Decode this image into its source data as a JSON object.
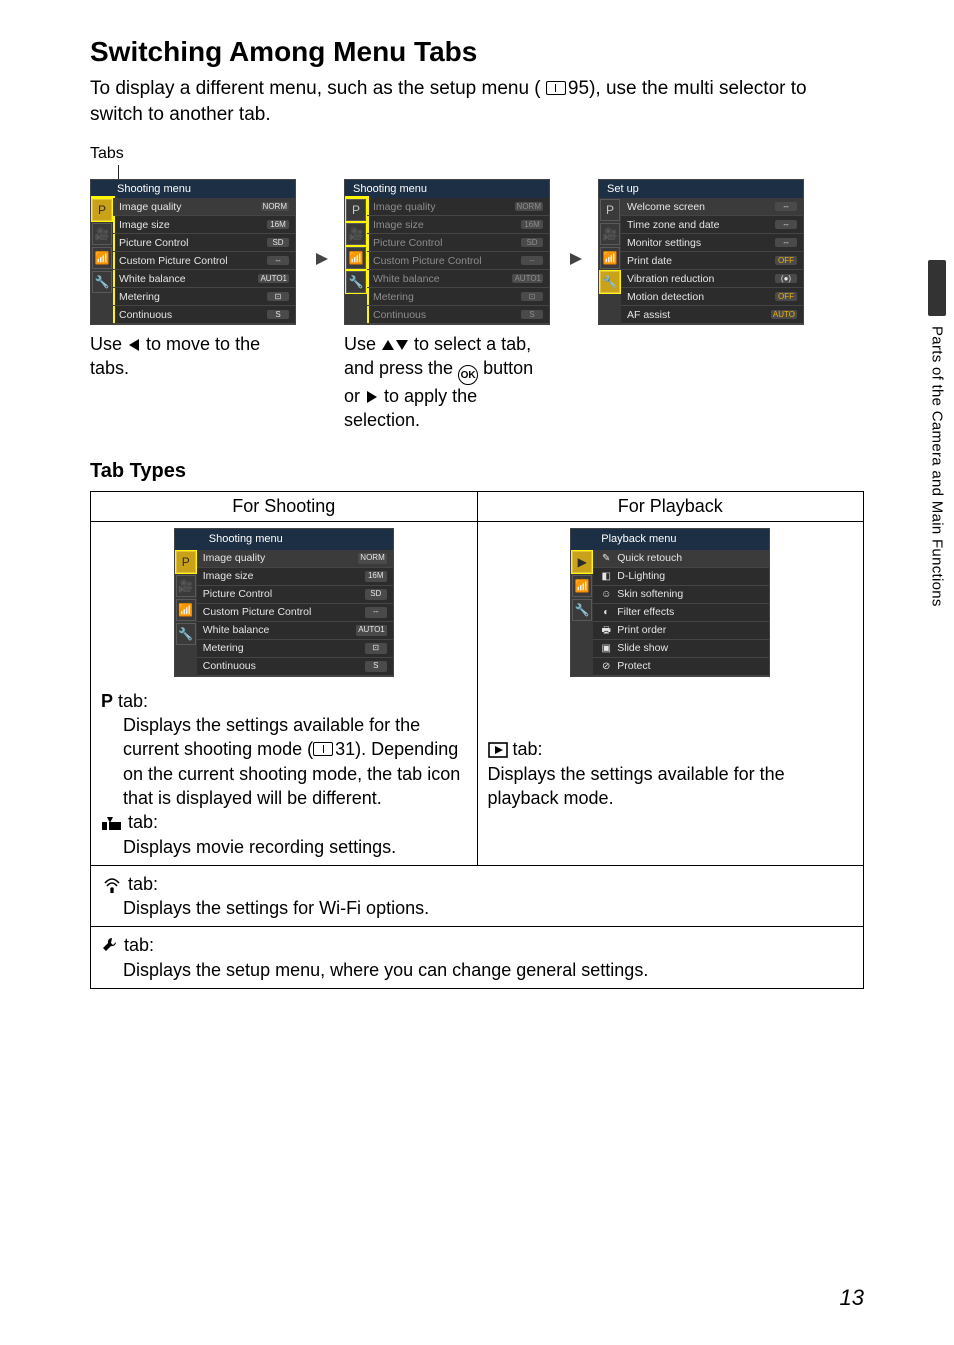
{
  "section_title": "Switching Among Menu Tabs",
  "intro_a": "To display a different menu, such as the setup menu (",
  "intro_ref": "95",
  "intro_b": "), use the multi selector to switch to another tab.",
  "tabs_label": "Tabs",
  "captions": {
    "left_a": "Use ",
    "left_b": " to move to the tabs.",
    "mid_a": "Use ",
    "mid_b": " to select a tab, and press the ",
    "mid_c": " button or ",
    "mid_d": " to apply the selection.",
    "ok_label": "OK"
  },
  "subhead": "Tab Types",
  "table_headers": {
    "shooting": "For Shooting",
    "playback": "For Playback"
  },
  "screens": {
    "shooting_title": "Shooting menu",
    "setup_title": "Set up",
    "playback_title": "Playback menu",
    "shooting_items": [
      {
        "label": "Image quality",
        "value": "NORM"
      },
      {
        "label": "Image size",
        "value": "16M"
      },
      {
        "label": "Picture Control",
        "value": "SD"
      },
      {
        "label": "Custom Picture Control",
        "value": "--"
      },
      {
        "label": "White balance",
        "value": "AUTO1"
      },
      {
        "label": "Metering",
        "value": "⊡"
      },
      {
        "label": "Continuous",
        "value": "S"
      }
    ],
    "setup_items": [
      {
        "label": "Welcome screen",
        "value": "--"
      },
      {
        "label": "Time zone and date",
        "value": "--"
      },
      {
        "label": "Monitor settings",
        "value": "--"
      },
      {
        "label": "Print date",
        "value": "OFF"
      },
      {
        "label": "Vibration reduction",
        "value": "(●)"
      },
      {
        "label": "Motion detection",
        "value": "OFF"
      },
      {
        "label": "AF assist",
        "value": "AUTO"
      }
    ],
    "playback_items": [
      {
        "label": "Quick retouch"
      },
      {
        "label": "D-Lighting"
      },
      {
        "label": "Skin softening"
      },
      {
        "label": "Filter effects"
      },
      {
        "label": "Print order"
      },
      {
        "label": "Slide show"
      },
      {
        "label": "Protect"
      }
    ]
  },
  "descriptions": {
    "p_tab_head": " tab:",
    "p_tab_body_a": "Displays the settings available for the current shooting mode (",
    "p_tab_ref": "31",
    "p_tab_body_b": "). Depending on the current shooting mode, the tab icon that is displayed will be different.",
    "movie_tab_head": " tab:",
    "movie_tab_body": "Displays movie recording settings.",
    "play_tab_head": " tab:",
    "play_tab_body": "Displays the settings available for the playback mode.",
    "wifi_tab_head": " tab:",
    "wifi_tab_body": "Displays the settings for Wi-Fi options.",
    "setup_tab_head": " tab:",
    "setup_tab_body": "Displays the setup menu, where you can change general settings."
  },
  "side_label": "Parts of the Camera and Main Functions",
  "page_number": "13",
  "tab_icons": [
    "P",
    "🎥",
    "📶",
    "🔧"
  ]
}
